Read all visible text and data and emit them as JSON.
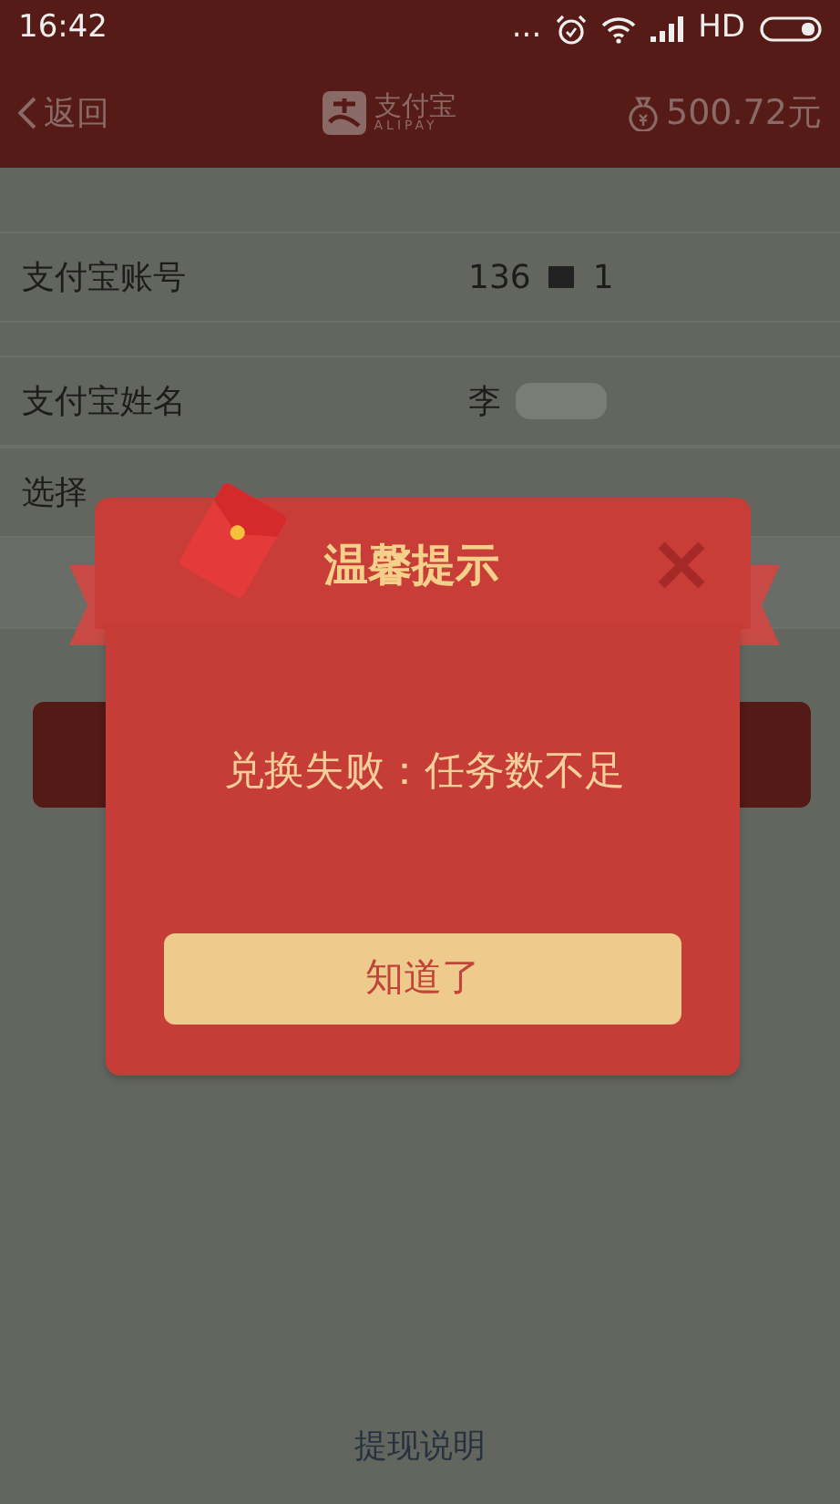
{
  "status_bar": {
    "time": "16:42",
    "dots": "...",
    "network": "HD"
  },
  "nav": {
    "back": "返回",
    "logo_text": "支付宝",
    "logo_sub": "ALIPAY",
    "balance": "500.72元"
  },
  "form_rows": [
    {
      "label": "支付宝账号",
      "value": "136",
      "value_tail": "1",
      "redacted": true
    },
    {
      "label": "支付宝姓名",
      "value": "李",
      "redacted": true
    },
    {
      "label": "选择"
    }
  ],
  "dialog": {
    "title": "温馨提示",
    "message": "兑换失败：任务数不足",
    "button": "知道了"
  },
  "footer_link": "提现说明"
}
